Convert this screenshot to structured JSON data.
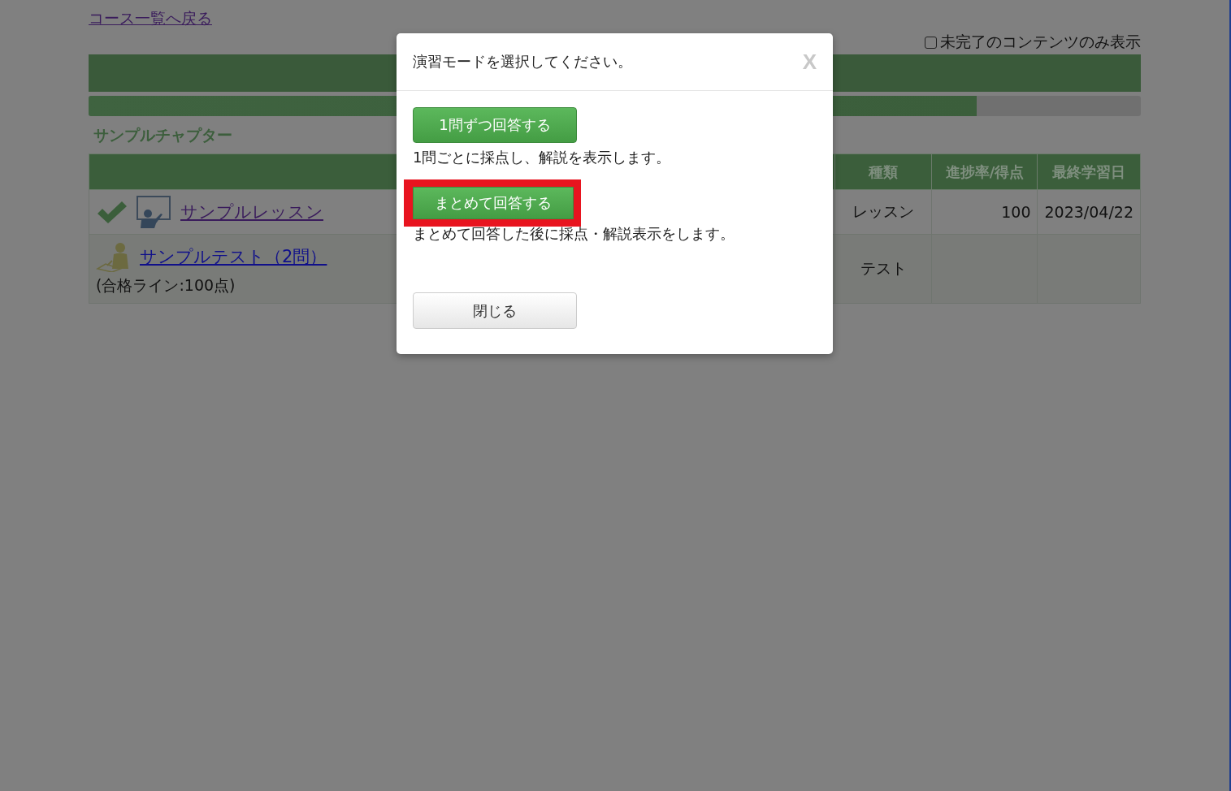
{
  "back_link": "コース一覧へ戻る",
  "filter": {
    "label": "未完了のコンテンツのみ表示",
    "checked": false
  },
  "progress": {
    "level": 0.844
  },
  "chapter": {
    "title": "サンプルチャプター"
  },
  "table": {
    "columns": [
      "",
      "種類",
      "進捗率/得点",
      "最終学習日"
    ],
    "rows": [
      {
        "kind": "lesson",
        "done": true,
        "title": "サンプルレッスン",
        "note": "",
        "type": "レッスン",
        "score": "100",
        "date": "2023/04/22"
      },
      {
        "kind": "test",
        "done": false,
        "title": "サンプルテスト（2問）",
        "note": "(合格ライン:100点)",
        "type": "テスト",
        "score": "",
        "date": ""
      }
    ]
  },
  "dialog": {
    "title": "演習モードを選択してください。",
    "close": "X",
    "options": [
      {
        "label": "1問ずつ回答する",
        "description": "1問ごとに採点し、解説を表示します。",
        "highlighted": false
      },
      {
        "label": "まとめて回答する",
        "description": "まとめて回答した後に採点・解説表示をします。",
        "highlighted": true
      }
    ],
    "close_button": "閉じる"
  }
}
